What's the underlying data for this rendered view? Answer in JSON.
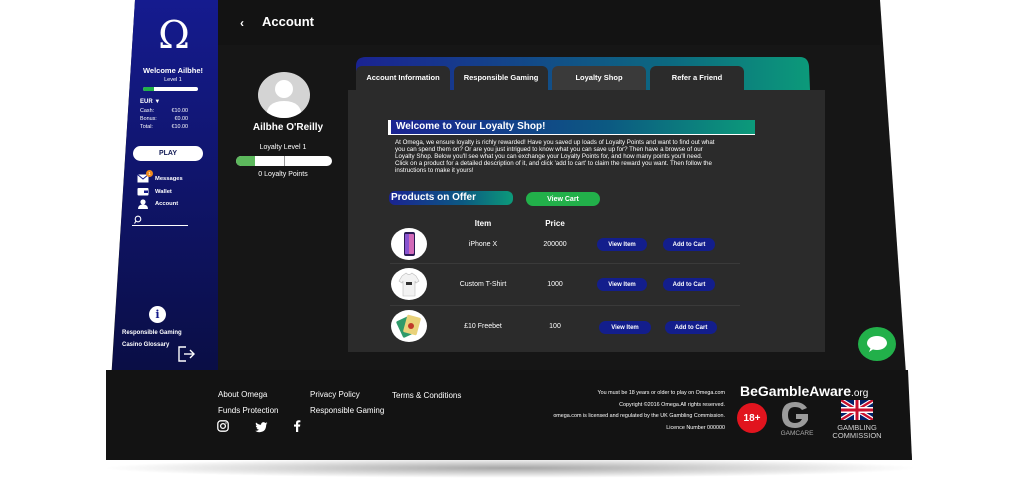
{
  "header": {
    "back_icon": "chevron-left-icon",
    "title": "Account"
  },
  "sidebar": {
    "logo": "Ω",
    "welcome": "Welcome Ailbhe!",
    "level": "Level 1",
    "currency": "EUR ▼",
    "balances": [
      {
        "label": "Cash:",
        "value": "€10.00"
      },
      {
        "label": "Bonus:",
        "value": "€0.00"
      },
      {
        "label": "Total:",
        "value": "€10.00"
      }
    ],
    "play_label": "PLAY",
    "nav": [
      {
        "icon": "envelope-icon",
        "label": "Messages",
        "badge": "1"
      },
      {
        "icon": "wallet-icon",
        "label": "Wallet"
      },
      {
        "icon": "person-icon",
        "label": "Account"
      }
    ],
    "search_icon": "search-icon",
    "responsible_gaming": "Responsible Gaming",
    "casino_glossary": "Casino Glossary",
    "info_icon": "info-icon",
    "logout_icon": "logout-icon"
  },
  "profile": {
    "name": "Ailbhe O'Reilly",
    "loyalty_level": "Loyalty Level 1",
    "loyalty_points": "0 Loyalty Points",
    "progress_fraction": 0.2
  },
  "tabs": [
    {
      "label": "Account Information",
      "active": false
    },
    {
      "label": "Responsible Gaming",
      "active": false
    },
    {
      "label": "Loyalty Shop",
      "active": true
    },
    {
      "label": "Refer a Friend",
      "active": false
    }
  ],
  "shop": {
    "title": "Welcome to Your Loyalty Shop!",
    "description": "At Omega, we ensure loyalty is richly rewarded! Have you saved up loads of Loyalty Points and want to find out what you can spend them on? Or are you just intrigued to know what you can save up for? Then have a browse of our Loyalty Shop. Below you'll see what you can exchange your Loyalty Points for, and how many points you'll need. Click on a product for a detailed description of it, and click 'add to cart' to claim the reward you want. Then follow the instructions to make it yours!",
    "products_heading": "Products on Offer",
    "view_cart": "View Cart",
    "col_item": "Item",
    "col_price": "Price",
    "view_item_label": "View Item",
    "add_to_cart_label": "Add to Cart",
    "products": [
      {
        "name": "iPhone X",
        "price": "200000"
      },
      {
        "name": "Custom T-Shirt",
        "price": "1000"
      },
      {
        "name": "£10 Freebet",
        "price": "100"
      }
    ]
  },
  "footer": {
    "links_col1": [
      "About Omega",
      "Funds Protection"
    ],
    "links_col2": [
      "Privacy Policy",
      "Responsible Gaming"
    ],
    "links_col3": [
      "Terms & Conditions"
    ],
    "social_icons": [
      "instagram-icon",
      "twitter-icon",
      "facebook-icon"
    ],
    "legal": [
      "You must be 18 years or older to play on Omega.com",
      "Copyright ©2016 Omega.All rights reserved.",
      "omega.com is licensed and regulated by the UK Gambling Commission.",
      "Licence Number 000000"
    ],
    "begambleaware_be": "Be",
    "begambleaware_gamble": "Gamble",
    "begambleaware_aware": "Aware",
    "begambleaware_org": ".org",
    "age_badge": "18+",
    "gamcare": "GAMCARE",
    "gambling_commission_1": "GAMBLING",
    "gambling_commission_2": "COMMISSION"
  },
  "chat_icon": "chat-bubble-icon",
  "colors": {
    "sidebar_top": "#141a8a",
    "sidebar_bottom": "#0a0f4a",
    "accent_green": "#22b04a",
    "dark_bg": "#161616",
    "panel_bg": "#2a2a2a"
  }
}
